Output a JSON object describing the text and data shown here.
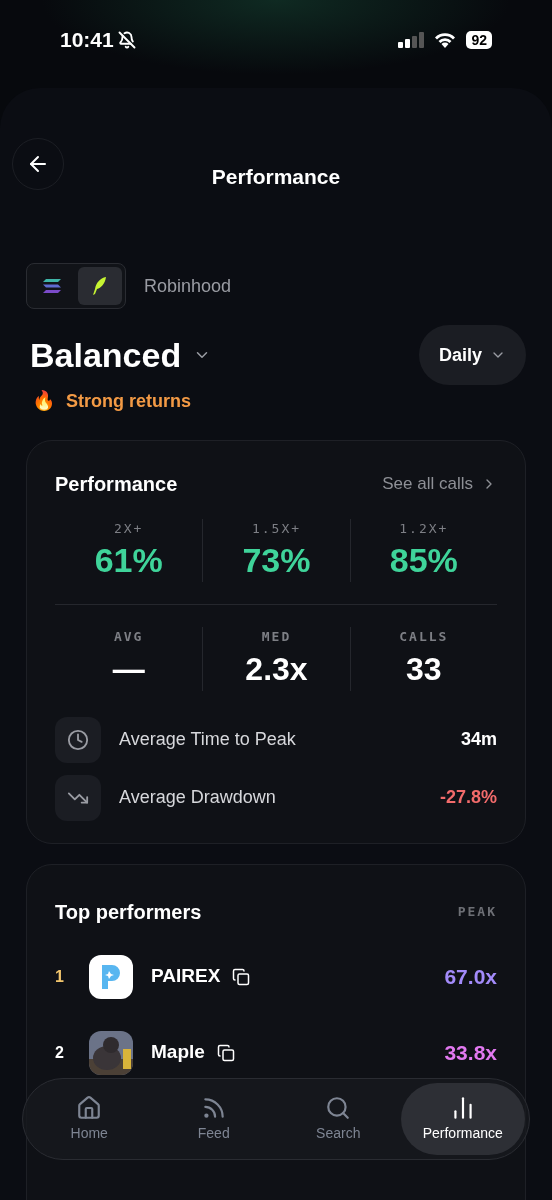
{
  "status_bar": {
    "time": "10:41",
    "silent": true,
    "battery": "92"
  },
  "header": {
    "title": "Performance"
  },
  "platforms": {
    "items": [
      {
        "kind": "solana",
        "selected": false
      },
      {
        "kind": "robinhood",
        "selected": true
      }
    ],
    "label": "Robinhood"
  },
  "strategy": {
    "name": "Balanced",
    "period": "Daily",
    "badge": "🔥",
    "tagline": "Strong returns"
  },
  "performance": {
    "title": "Performance",
    "link": "See all calls",
    "rates": [
      {
        "label": "2X+",
        "value": "61%"
      },
      {
        "label": "1.5X+",
        "value": "73%"
      },
      {
        "label": "1.2X+",
        "value": "85%"
      }
    ],
    "stats": [
      {
        "label": "AVG",
        "value": "—"
      },
      {
        "label": "MED",
        "value": "2.3x"
      },
      {
        "label": "CALLS",
        "value": "33"
      }
    ],
    "metrics": [
      {
        "kind": "clock",
        "label": "Average Time to Peak",
        "value": "34m",
        "color": "#ffffff"
      },
      {
        "kind": "drawdown",
        "label": "Average Drawdown",
        "value": "-27.8%",
        "color": "#f26b6b"
      }
    ]
  },
  "top_performers": {
    "title": "Top performers",
    "column": "PEAK",
    "rows": [
      {
        "rank": {
          "label": "1",
          "color": "#f2c66d"
        },
        "logo": {
          "kind": "letter"
        },
        "name": "PAIREX",
        "peak": "67.0x",
        "color": "#a38bfa"
      },
      {
        "rank": {
          "label": "2",
          "color": "#ffffff"
        },
        "name": "Maple",
        "peak": "33.8x",
        "color": "#e279f0"
      }
    ]
  },
  "nav": [
    {
      "kind": "home",
      "label": "Home",
      "selected": false
    },
    {
      "kind": "feed",
      "label": "Feed",
      "selected": false
    },
    {
      "kind": "search",
      "label": "Search",
      "selected": false
    },
    {
      "kind": "chart",
      "label": "Performance",
      "selected": true
    }
  ]
}
